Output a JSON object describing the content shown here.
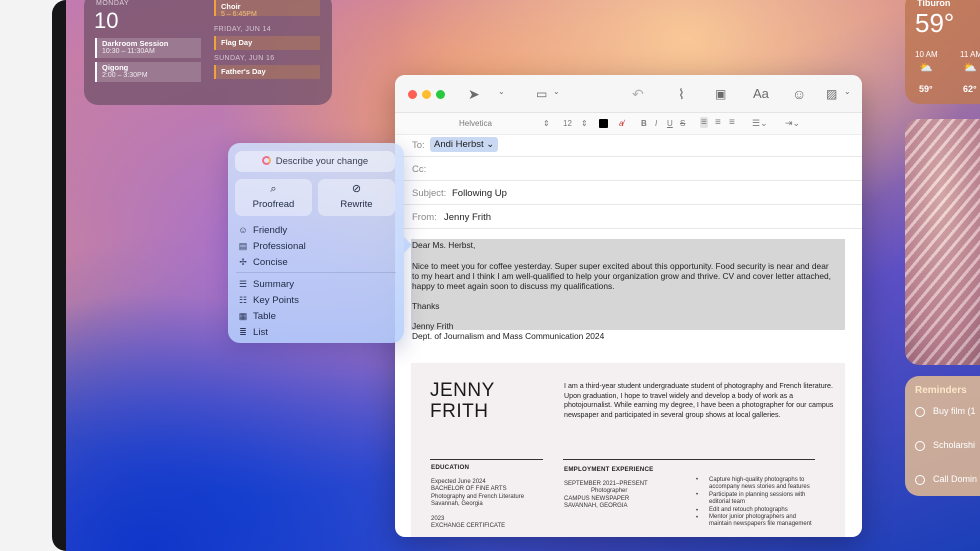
{
  "calendar": {
    "dow": "MONDAY",
    "day": "10",
    "events_left": [
      {
        "title": "Darkroom Session",
        "time": "10:30 – 11:30AM"
      },
      {
        "title": "Qigong",
        "time": "2:00 – 3:30PM"
      }
    ],
    "top_event": {
      "title": "Choir",
      "time": "5 – 6:45PM"
    },
    "day2_header": "FRIDAY, JUN 14",
    "day2_event": "Flag Day",
    "day3_header": "SUNDAY, JUN 16",
    "day3_event": "Father's Day"
  },
  "weather": {
    "city": "Tiburon",
    "temp": "59°",
    "hours": [
      "10 AM",
      "11 AM"
    ],
    "temps": [
      "59°",
      "62°"
    ]
  },
  "reminders": {
    "title": "Reminders",
    "items": [
      "Buy film (1",
      "Scholarshi",
      "Call Domin"
    ]
  },
  "mail": {
    "toolbar": {
      "icons": [
        "send-icon",
        "header-fields-icon",
        "reply-icon",
        "attach-icon",
        "markup-icon",
        "format-icon",
        "emoji-icon",
        "photo-browser-icon"
      ],
      "format_label": "Aa"
    },
    "format_bar": {
      "font": "Helvetica",
      "size": "12",
      "bold": "B",
      "italic": "I",
      "underline": "U",
      "strike": "S"
    },
    "to_label": "To:",
    "to_value": "Andi Herbst",
    "cc_label": "Cc:",
    "subject_label": "Subject:",
    "subject_value": "Following Up",
    "from_label": "From:",
    "from_value": "Jenny Frith",
    "body": {
      "greeting": "Dear Ms. Herbst,",
      "para1_line1": "Nice to meet you for coffee yesterday. Super super excited about this opportunity. Food security is near and dear",
      "para1_line2": "to my heart and I think I am well-qualified to help your organization grow and thrive. CV and cover letter attached,",
      "para1_line3": "happy to meet again soon to discuss my qualifications.",
      "thanks": "Thanks",
      "sig_name": "Jenny Frith",
      "sig_dept": "Dept. of Journalism and Mass Communication 2024"
    },
    "resume": {
      "first": "JENNY",
      "last": "FRITH",
      "intro": "I am a third-year student undergraduate student of photography and French literature. Upon graduation, I hope to travel widely and develop a body of work as a photojournalist. While earning my degree, I have been a photographer for our campus newspaper and participated in several group shows at local galleries.",
      "education_head": "EDUCATION",
      "edu_lines": [
        "Expected June 2024",
        "BACHELOR OF FINE ARTS",
        "Photography and French Literature",
        "Savannah, Georgia"
      ],
      "edu_year": "2023",
      "edu_cert": "EXCHANGE CERTIFICATE",
      "employment_head": "EMPLOYMENT EXPERIENCE",
      "emp_lines": [
        "SEPTEMBER 2021–PRESENT",
        "Photographer",
        "CAMPUS NEWSPAPER",
        "SAVANNAH, GEORGIA"
      ],
      "bullets": [
        "Capture high-quality photographs to",
        "accompany news stories and features",
        "Participate in planning sessions with",
        "editorial team",
        "Edit and retouch photographs",
        "Mentor junior photographers and",
        "maintain newspapers file management"
      ]
    }
  },
  "writing_tools": {
    "search_placeholder": "Describe your change",
    "proofread": "Proofread",
    "rewrite": "Rewrite",
    "tones": [
      "Friendly",
      "Professional",
      "Concise"
    ],
    "formats": [
      "Summary",
      "Key Points",
      "Table",
      "List"
    ]
  }
}
